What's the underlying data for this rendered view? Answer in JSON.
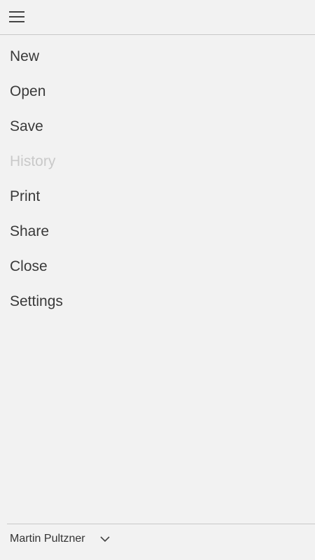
{
  "header": {
    "menu_icon": "hamburger-menu-icon"
  },
  "menu": {
    "items": [
      {
        "label": "New",
        "enabled": true
      },
      {
        "label": "Open",
        "enabled": true
      },
      {
        "label": "Save",
        "enabled": true
      },
      {
        "label": "History",
        "enabled": false
      },
      {
        "label": "Print",
        "enabled": true
      },
      {
        "label": "Share",
        "enabled": true
      },
      {
        "label": "Close",
        "enabled": true
      },
      {
        "label": "Settings",
        "enabled": true
      }
    ]
  },
  "account": {
    "name": "Martin Pultzner",
    "dropdown_icon": "chevron-down-icon"
  },
  "colors": {
    "background": "#f2f2f2",
    "text": "#3a3a3a",
    "disabled_text": "#c9c9c9",
    "divider": "#c8c8c8"
  }
}
